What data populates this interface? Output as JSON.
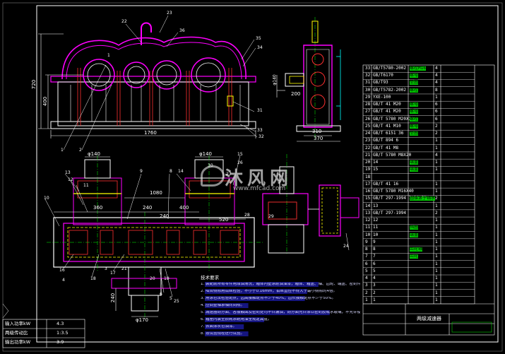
{
  "palette": {
    "background": "#000000",
    "frame": "#ffffff",
    "housing": "#ff00ff",
    "part_lines": "#ff3030",
    "dimensions": "#ffffff",
    "gear": "#ffff00",
    "centerline": "#00ff00",
    "cyan": "#00ffff",
    "note_text": "#d8d8ff",
    "highlight": "#00d000"
  },
  "front_view": {
    "dim_height_total": "720",
    "dim_height_center": "400",
    "dim_width": "1760",
    "labels": {
      "top_left": "22",
      "top_mid": "23",
      "top_right": "36",
      "right1": "35",
      "right2": "34",
      "right3": "31",
      "right4": "33",
      "right5": "32",
      "left_bottom": "1",
      "mid_bottom": "2",
      "upper_mid": "1"
    }
  },
  "side_view": {
    "dim_shaft": "200",
    "dim_base1": "310",
    "dim_base2": "370",
    "label_center": "φ140"
  },
  "plan_view": {
    "dim_d1": "φ140",
    "dim_d2": "φ140",
    "dim_span": "1080",
    "dim_a": "360",
    "dim_b": "240",
    "dim_c": "400",
    "dim_d": "520",
    "dim_e": "240",
    "dim_bottom": "φ170",
    "labels": [
      "13",
      "12",
      "11",
      "10",
      "9",
      "8",
      "14",
      "15",
      "16",
      "18",
      "17",
      "6",
      "5",
      "4",
      "3",
      "21",
      "20",
      "19",
      "25",
      "26",
      "30",
      "27",
      "28",
      "29",
      "24"
    ]
  },
  "bom": {
    "rows": [
      {
        "code": "GB/T5780-2002",
        "name": "螺栓M16",
        "qty": "4"
      },
      {
        "code": "GB/T6170",
        "name": "螺母",
        "qty": "4"
      },
      {
        "code": "GB/T93",
        "name": "垫圈",
        "qty": "4"
      },
      {
        "code": "GB/T5782-2002",
        "name": "螺栓",
        "qty": "8"
      },
      {
        "code": "YXE-100",
        "name": "",
        "qty": "1"
      },
      {
        "code": "GB/T 41  M20",
        "name": "螺母",
        "qty": "6"
      },
      {
        "code": "GB/T 41  M20",
        "name": "螺母",
        "qty": "6"
      },
      {
        "code": "GB/T 5780 M20X30",
        "name": "螺栓",
        "qty": "6"
      },
      {
        "code": "GB/T 41  M10",
        "name": "螺母",
        "qty": "2"
      },
      {
        "code": "GB/T 6151  36",
        "name": "垫圈",
        "qty": "2"
      },
      {
        "code": "GB/T 894  6",
        "name": "",
        "qty": "1"
      },
      {
        "code": "GB/T 41  M8",
        "name": "",
        "qty": "1"
      },
      {
        "code": "GB/T 5780 M8X20",
        "name": "",
        "qty": "4"
      },
      {
        "code": "14",
        "name": "端盖",
        "qty": "1"
      },
      {
        "code": "15",
        "name": "端盖",
        "qty": "1"
      },
      {
        "code": "",
        "name": "",
        "qty": ""
      },
      {
        "code": "GB/T 41  16",
        "name": "",
        "qty": "1"
      },
      {
        "code": "GB/T 5780 M16X40",
        "name": "",
        "qty": "1"
      },
      {
        "code": "GB/T 297-1994 7018-00",
        "name": "圆锥滚子轴承",
        "qty": "2"
      },
      {
        "code": "13",
        "name": "",
        "qty": "1"
      },
      {
        "code": "GB/T 297-1994",
        "name": "",
        "qty": "2"
      },
      {
        "code": "12",
        "name": "",
        "qty": "1"
      },
      {
        "code": "11",
        "name": "挡圈",
        "qty": "1"
      },
      {
        "code": "10",
        "name": "端盖",
        "qty": "1"
      },
      {
        "code": "9",
        "name": "",
        "qty": "1"
      },
      {
        "code": "8",
        "name": "齿轮轴",
        "qty": "1"
      },
      {
        "code": "7",
        "name": "齿轮",
        "qty": "1"
      },
      {
        "code": "6",
        "name": "",
        "qty": "1"
      },
      {
        "code": "5",
        "name": "",
        "qty": "1"
      },
      {
        "code": "4",
        "name": "",
        "qty": "1"
      },
      {
        "code": "3",
        "name": "",
        "qty": "1"
      },
      {
        "code": "2",
        "name": "",
        "qty": "1"
      },
      {
        "code": "1",
        "name": "",
        "qty": "1"
      }
    ],
    "title_block": "两级减速器"
  },
  "params": [
    {
      "label": "输入功率kW",
      "value": "4.3"
    },
    {
      "label": "两级传动比",
      "value": "1:3.5"
    },
    {
      "label": "输出功率kW",
      "value": "3.9"
    }
  ],
  "notes_title": "技术要求",
  "notes": [
    "1. 装配前所有零件用煤油清洗，箱体内壁涂耐油油漆，箱体、箱盖、轴、齿轮、端盖、密封件等",
    "2. 啮合侧隙用铅丝检验，不小于0.16mm，铅丝直径不得大于最小侧隙的4倍。",
    "3. 用涂色法检验斑点，齿高接触斑点不少于40%，齿长接触斑点不少于50%。",
    "4. 应调整轴承轴向间隙。",
    "5. 减速器剖分面、各接触面及密封处均不许漏油，剖分面允许涂以密封胶或水玻璃，不允许使用任何填料。",
    "6. 箱座内装全损耗系统用油至规定高度。",
    "7. 表面涂灰色油漆。",
    "8. 按试验规程进行试验。"
  ],
  "watermark": {
    "brand": "沐风网",
    "url": "www.mfcad.com"
  }
}
